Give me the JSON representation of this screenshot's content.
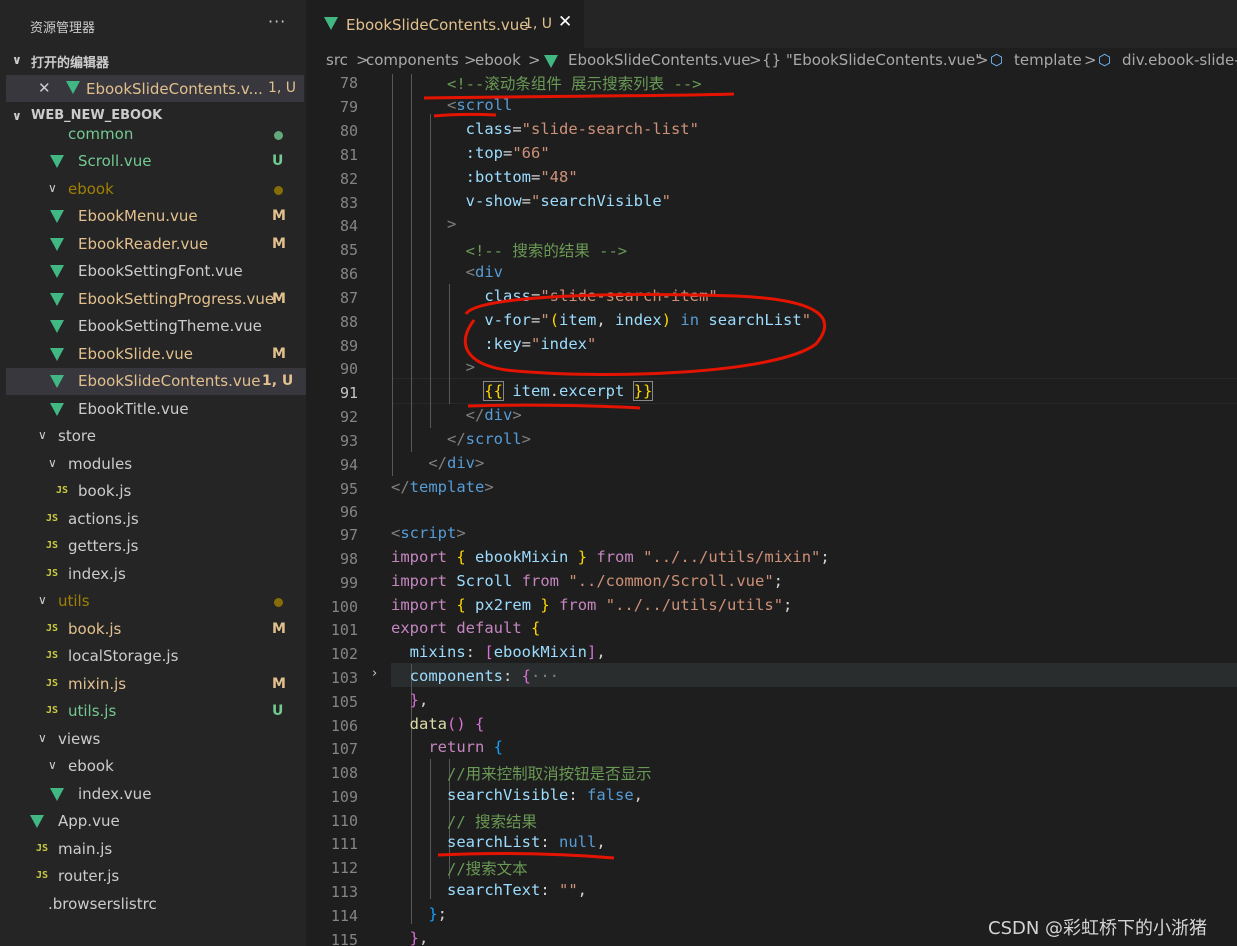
{
  "sidebar": {
    "title": "资源管理器",
    "more": "···",
    "open_editors_label": "打开的编辑器",
    "open_editor": {
      "name": "EbookSlideContents.v...",
      "status": "1, U"
    },
    "project_label": "WEB_NEW_EBOOK",
    "tree": [
      {
        "name": "common",
        "status": "",
        "dot": "#73c991"
      },
      {
        "name": "Scroll.vue",
        "status": "U"
      },
      {
        "name": "ebook",
        "status": "",
        "dot": "#a08000"
      },
      {
        "name": "EbookMenu.vue",
        "status": "M"
      },
      {
        "name": "EbookReader.vue",
        "status": "M"
      },
      {
        "name": "EbookSettingFont.vue",
        "status": ""
      },
      {
        "name": "EbookSettingProgress.vue",
        "status": "M"
      },
      {
        "name": "EbookSettingTheme.vue",
        "status": ""
      },
      {
        "name": "EbookSlide.vue",
        "status": "M"
      },
      {
        "name": "EbookSlideContents.vue",
        "status": "1, U"
      },
      {
        "name": "EbookTitle.vue",
        "status": ""
      },
      {
        "name": "store",
        "status": ""
      },
      {
        "name": "modules",
        "status": ""
      },
      {
        "name": "book.js",
        "status": ""
      },
      {
        "name": "actions.js",
        "status": ""
      },
      {
        "name": "getters.js",
        "status": ""
      },
      {
        "name": "index.js",
        "status": ""
      },
      {
        "name": "utils",
        "status": "",
        "dot": "#a08000"
      },
      {
        "name": "book.js",
        "status": "M"
      },
      {
        "name": "localStorage.js",
        "status": ""
      },
      {
        "name": "mixin.js",
        "status": "M"
      },
      {
        "name": "utils.js",
        "status": "U"
      },
      {
        "name": "views",
        "status": ""
      },
      {
        "name": "ebook",
        "status": ""
      },
      {
        "name": "index.vue",
        "status": ""
      },
      {
        "name": "App.vue",
        "status": ""
      },
      {
        "name": "main.js",
        "status": ""
      },
      {
        "name": "router.js",
        "status": ""
      },
      {
        "name": ".browserslistrc",
        "status": ""
      }
    ]
  },
  "tab": {
    "name": "EbookSlideContents.vue",
    "status": "1, U",
    "close": "✕"
  },
  "breadcrumb": [
    "src",
    "components",
    "ebook",
    "EbookSlideContents.vue",
    "{} \"EbookSlideContents.vue\"",
    "template",
    "div.ebook-slide-"
  ],
  "breadcrumb_sep": ">",
  "editor": {
    "line_numbers": [
      "78",
      "79",
      "80",
      "81",
      "82",
      "83",
      "84",
      "85",
      "86",
      "87",
      "88",
      "89",
      "90",
      "91",
      "92",
      "93",
      "94",
      "95",
      "96",
      "97",
      "98",
      "99",
      "100",
      "101",
      "102",
      "103",
      "105",
      "106",
      "107",
      "108",
      "109",
      "110",
      "111",
      "112",
      "113",
      "114",
      "115"
    ],
    "current_line": "91",
    "folded_line": "103",
    "fold_marker": "›"
  },
  "watermark": "CSDN @彩虹桥下的小浙猪",
  "colors": {
    "accent_modified": "#e2c08d",
    "untracked": "#73c991",
    "vue_icon": "#41b883",
    "annotation": "#e51400"
  }
}
